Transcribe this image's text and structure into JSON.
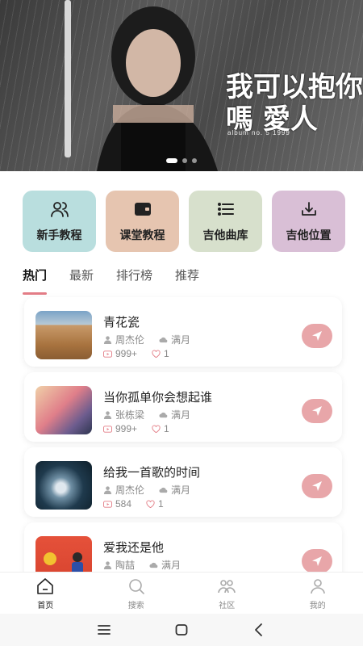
{
  "banner": {
    "title_art": "我可以抱你嗎 愛人",
    "small_text": "album no. 5 1999",
    "slide_count": 3,
    "active_slide": 1
  },
  "categories": [
    {
      "label": "新手教程",
      "icon": "users-icon",
      "color": "#b9dede"
    },
    {
      "label": "课堂教程",
      "icon": "wallet-icon",
      "color": "#e6c5b0"
    },
    {
      "label": "吉他曲库",
      "icon": "list-icon",
      "color": "#d7e0cc"
    },
    {
      "label": "吉他位置",
      "icon": "download-icon",
      "color": "#d9bfd6"
    }
  ],
  "tabs": [
    {
      "label": "热门",
      "active": true
    },
    {
      "label": "最新",
      "active": false
    },
    {
      "label": "排行榜",
      "active": false
    },
    {
      "label": "推荐",
      "active": false
    }
  ],
  "songs": [
    {
      "title": "青花瓷",
      "artist": "周杰伦",
      "mood": "满月",
      "plays": "999+",
      "likes": "1",
      "thumb": "desert"
    },
    {
      "title": "当你孤单你会想起谁",
      "artist": "张栋梁",
      "mood": "满月",
      "plays": "999+",
      "likes": "1",
      "thumb": "building"
    },
    {
      "title": "给我一首歌的时间",
      "artist": "周杰伦",
      "mood": "满月",
      "plays": "584",
      "likes": "1",
      "thumb": "wave"
    },
    {
      "title": "爱我还是他",
      "artist": "陶喆",
      "mood": "满月",
      "plays": "",
      "likes": "",
      "thumb": "red"
    }
  ],
  "bottom_nav": [
    {
      "label": "首页",
      "icon": "home-icon",
      "active": true
    },
    {
      "label": "搜索",
      "icon": "search-icon",
      "active": false
    },
    {
      "label": "社区",
      "icon": "community-icon",
      "active": false
    },
    {
      "label": "我的",
      "icon": "profile-icon",
      "active": false
    }
  ],
  "system_nav": [
    "menu-icon",
    "home-square-icon",
    "back-icon"
  ],
  "colors": {
    "accent": "#e37d86",
    "send_button": "#e8a6a9"
  }
}
